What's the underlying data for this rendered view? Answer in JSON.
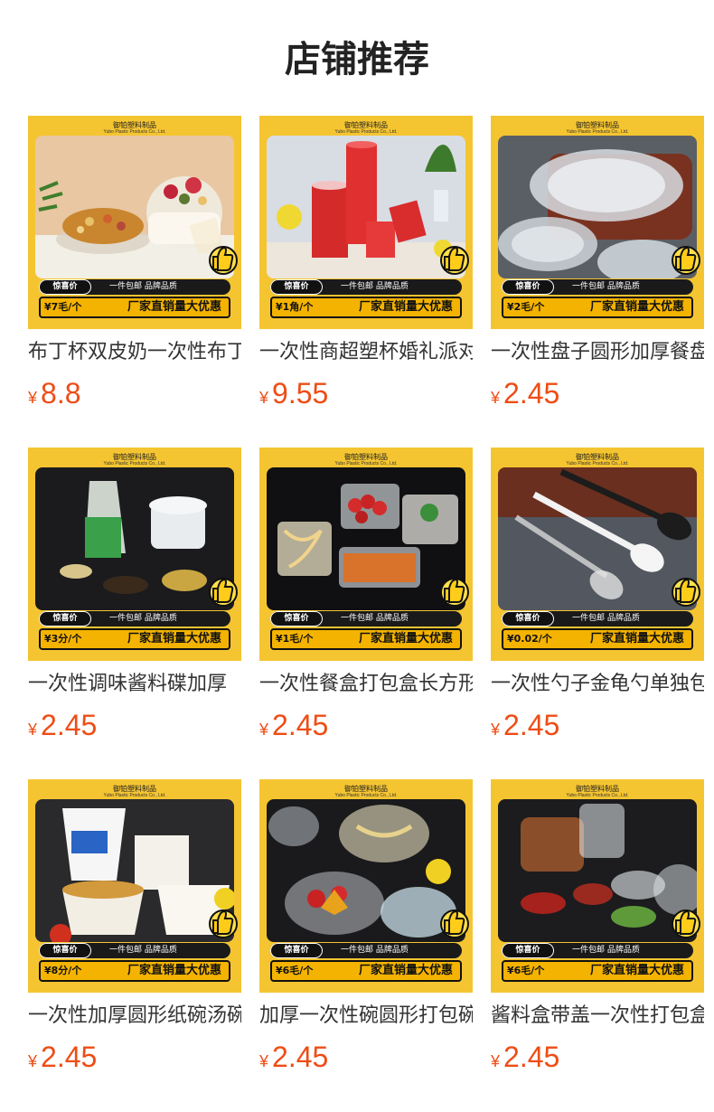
{
  "header": {
    "title": "店铺推荐"
  },
  "banner": {
    "brand_cn": "御铂塑料制品",
    "brand_en": "Yubo Plastic Products Co., Ltd.",
    "surprise_label": "惊喜价",
    "perks": "一件包邮 品牌品质",
    "promo": "厂家直销量大优惠"
  },
  "currency_symbol": "¥",
  "products": [
    {
      "title": "布丁杯双皮奶一次性布丁杯",
      "price": "8.8",
      "unit_price": "¥7毛/个",
      "scene": "pudding"
    },
    {
      "title": "一次性商超塑杯婚礼派对杯",
      "price": "9.55",
      "unit_price": "¥1角/个",
      "scene": "cups"
    },
    {
      "title": "一次性盘子圆形加厚餐盘",
      "price": "2.45",
      "unit_price": "¥2毛/个",
      "scene": "plates"
    },
    {
      "title": "一次性调味酱料碟加厚",
      "price": "2.45",
      "unit_price": "¥3分/个",
      "scene": "sauce"
    },
    {
      "title": "一次性餐盒打包盒长方形",
      "price": "2.45",
      "unit_price": "¥1毛/个",
      "scene": "boxes"
    },
    {
      "title": "一次性勺子金龟勺单独包装",
      "price": "2.45",
      "unit_price": "¥0.02/个",
      "scene": "spoons"
    },
    {
      "title": "一次性加厚圆形纸碗汤碗",
      "price": "2.45",
      "unit_price": "¥8分/个",
      "scene": "paperbowls"
    },
    {
      "title": "加厚一次性碗圆形打包碗",
      "price": "2.45",
      "unit_price": "¥6毛/个",
      "scene": "bowls"
    },
    {
      "title": "酱料盒带盖一次性打包盒",
      "price": "2.45",
      "unit_price": "¥6毛/个",
      "scene": "saucecups"
    }
  ]
}
